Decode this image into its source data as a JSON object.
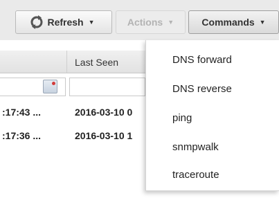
{
  "toolbar": {
    "refresh_label": "Refresh",
    "actions_label": "Actions",
    "commands_label": "Commands"
  },
  "grid": {
    "headers": {
      "last_seen": "Last Seen"
    },
    "rows": [
      {
        "time": ":17:43 ...",
        "last_seen": "2016-03-10 0"
      },
      {
        "time": ":17:36 ...",
        "last_seen": "2016-03-10 1"
      }
    ]
  },
  "commands_menu": {
    "items": [
      "DNS forward",
      "DNS reverse",
      "ping",
      "snmpwalk",
      "traceroute"
    ]
  },
  "icons": {
    "refresh": "refresh-icon",
    "caret": "caret-down-icon",
    "calendar": "calendar-icon"
  },
  "colors": {
    "toolbar_bg": "#eaeaea",
    "disabled_text": "#b3b3b3",
    "refresh_icon": "#555555"
  }
}
